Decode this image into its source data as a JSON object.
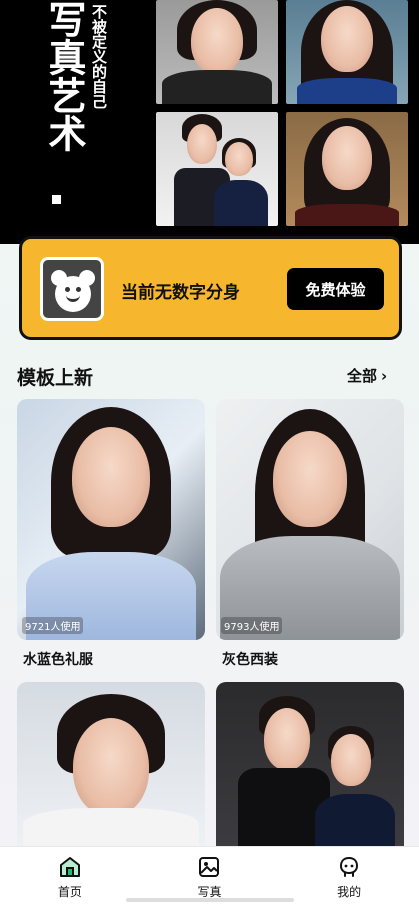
{
  "hero": {
    "title": "写真艺术",
    "subtitle": "不被定义的自己"
  },
  "avatar_card": {
    "status_text": "当前无数字分身",
    "trial_button": "免费体验"
  },
  "section": {
    "title": "模板上新",
    "see_all": "全部"
  },
  "templates": [
    {
      "name": "水蓝色礼服",
      "usage": "9721人使用"
    },
    {
      "name": "灰色西装",
      "usage": "9793人使用"
    },
    {
      "name": "",
      "usage": ""
    },
    {
      "name": "",
      "usage": ""
    }
  ],
  "nav": {
    "items": [
      {
        "label": "首页",
        "icon": "home-icon",
        "active": true
      },
      {
        "label": "写真",
        "icon": "photo-icon",
        "active": false
      },
      {
        "label": "我的",
        "icon": "profile-icon",
        "active": false
      }
    ]
  },
  "colors": {
    "card_accent": "#f6b72e",
    "active_nav": "#2bb673",
    "ink": "#111111"
  }
}
